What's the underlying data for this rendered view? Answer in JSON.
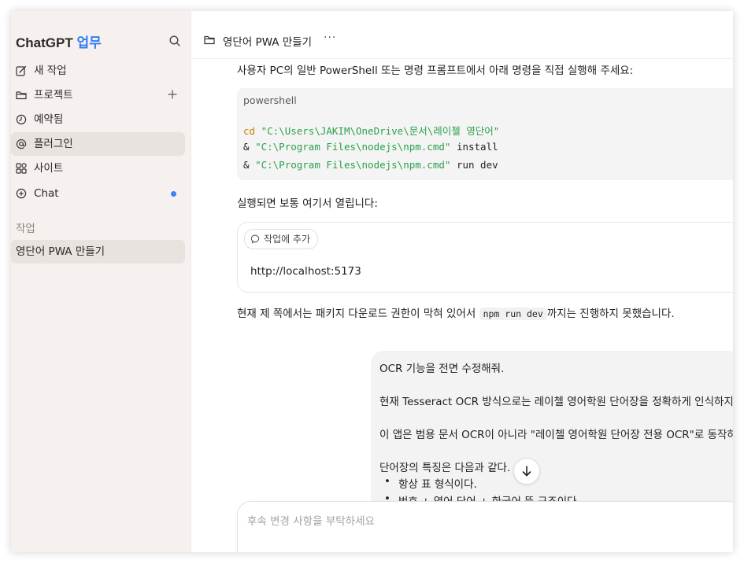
{
  "sidebar": {
    "brand": "ChatGPT",
    "brand_accent": "업무",
    "items": [
      {
        "label": "새 작업",
        "icon": "edit-icon"
      },
      {
        "label": "프로젝트",
        "icon": "folder-icon"
      },
      {
        "label": "예약됨",
        "icon": "clock-icon"
      },
      {
        "label": "플러그인",
        "icon": "at-icon"
      },
      {
        "label": "사이트",
        "icon": "grid-icon"
      },
      {
        "label": "Chat",
        "icon": "chat-plus-icon"
      }
    ],
    "section_label": "작업",
    "task": "영단어 PWA 만들기"
  },
  "header": {
    "title": "영단어 PWA 만들기",
    "more": "···"
  },
  "assistant": {
    "intro": "사용자 PC의 일반 PowerShell 또는 명령 프롬프트에서 아래 명령을 직접 실행해 주세요:",
    "code_lang": "powershell",
    "code": {
      "l1_kw": "cd",
      "l1_str": "\"C:\\Users\\JAKIM\\OneDrive\\문서\\레이첼 영단어\"",
      "l2_amp": "&",
      "l2_str": "\"C:\\Program Files\\nodejs\\npm.cmd\"",
      "l2_arg": "install",
      "l3_amp": "&",
      "l3_str": "\"C:\\Program Files\\nodejs\\npm.cmd\"",
      "l3_arg": "run dev"
    },
    "after_run": "실행되면 보통 여기서 열립니다:",
    "add_to_task": "작업에 추가",
    "url": "http://localhost:5173",
    "note_before": "현재 제 쪽에서는 패키지 다운로드 권한이 막혀 있어서",
    "note_code": "npm run dev",
    "note_after": "까지는 진행하지 못했습니다."
  },
  "user_message": {
    "line1": "OCR 기능을 전면 수정해줘.",
    "line2": "현재 Tesseract OCR 방식으로는 레이첼 영어학원 단어장을 정확하게 인식하지",
    "line3": "이 앱은 범용 문서 OCR이 아니라 \"레이첼 영어학원 단어장 전용 OCR\"로 동작하",
    "line4": "단어장의 특징은 다음과 같다.",
    "bullets": [
      "항상 표 형식이다.",
      "번호 + 영어 단어 + 한국어 뜻 구조이다."
    ]
  },
  "composer": {
    "placeholder": "후속 변경 사항을 부탁하세요"
  },
  "colors": {
    "accent": "#2f7cf6",
    "sidebar_bg": "#f6f1ee",
    "notification_dot": "#3b82f6"
  }
}
